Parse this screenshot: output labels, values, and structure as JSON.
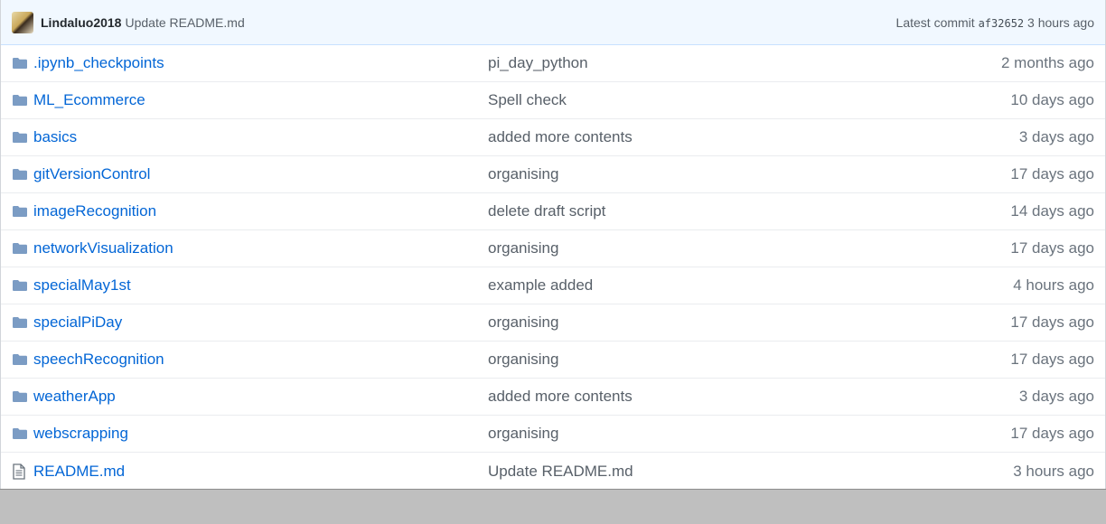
{
  "commit": {
    "author": "Lindaluo2018",
    "message": "Update README.md",
    "latest_label": "Latest commit",
    "sha": "af32652",
    "time": "3 hours ago"
  },
  "files": [
    {
      "type": "folder",
      "icon": "folder-icon",
      "name": ".ipynb_checkpoints",
      "message": "pi_day_python",
      "age": "2 months ago"
    },
    {
      "type": "folder",
      "icon": "folder-icon",
      "name": "ML_Ecommerce",
      "message": "Spell check",
      "age": "10 days ago"
    },
    {
      "type": "folder",
      "icon": "folder-icon",
      "name": "basics",
      "message": "added more contents",
      "age": "3 days ago"
    },
    {
      "type": "folder",
      "icon": "folder-icon",
      "name": "gitVersionControl",
      "message": "organising",
      "age": "17 days ago"
    },
    {
      "type": "folder",
      "icon": "folder-icon",
      "name": "imageRecognition",
      "message": "delete draft script",
      "age": "14 days ago"
    },
    {
      "type": "folder",
      "icon": "folder-icon",
      "name": "networkVisualization",
      "message": "organising",
      "age": "17 days ago"
    },
    {
      "type": "folder",
      "icon": "folder-icon",
      "name": "specialMay1st",
      "message": "example added",
      "age": "4 hours ago"
    },
    {
      "type": "folder",
      "icon": "folder-icon",
      "name": "specialPiDay",
      "message": "organising",
      "age": "17 days ago"
    },
    {
      "type": "folder",
      "icon": "folder-icon",
      "name": "speechRecognition",
      "message": "organising",
      "age": "17 days ago"
    },
    {
      "type": "folder",
      "icon": "folder-icon",
      "name": "weatherApp",
      "message": "added more contents",
      "age": "3 days ago"
    },
    {
      "type": "folder",
      "icon": "folder-icon",
      "name": "webscrapping",
      "message": "organising",
      "age": "17 days ago"
    },
    {
      "type": "file",
      "icon": "file-icon",
      "name": "README.md",
      "message": "Update README.md",
      "age": "3 hours ago"
    }
  ],
  "colors": {
    "link": "#0366d6",
    "folder": "#79b8ff",
    "muted": "#586069"
  }
}
